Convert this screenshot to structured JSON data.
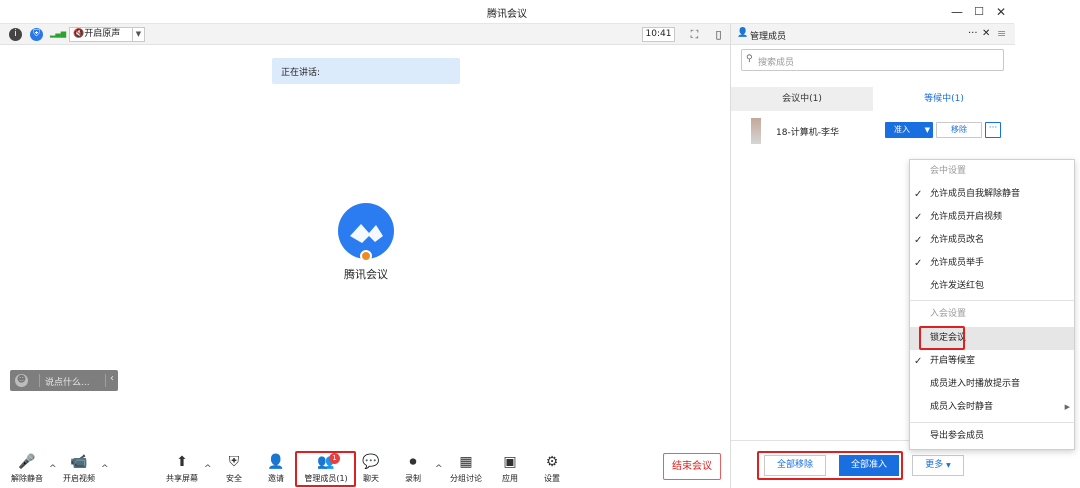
{
  "window": {
    "title": "腾讯会议",
    "minimize": "—",
    "maximize": "☐",
    "close": "✕"
  },
  "infobar": {
    "info_icon": "i",
    "shield_icon": "⛨",
    "signal_icon": "▂▄▆",
    "original_sound_label": "开启原声",
    "time": "10:41",
    "fullscreen_icon": "⛶",
    "layout_icon": "▯"
  },
  "stage": {
    "speaking_label": "正在讲话:",
    "app_name": "腾讯会议",
    "chat_placeholder": "说点什么..."
  },
  "toolbar": {
    "items": [
      {
        "label": "解除静音",
        "icon": "🎤"
      },
      {
        "label": "开启视频",
        "icon": "📹"
      },
      {
        "label": "共享屏幕",
        "icon": "⬆"
      },
      {
        "label": "安全",
        "icon": "⛨"
      },
      {
        "label": "邀请",
        "icon": "👤"
      },
      {
        "label": "管理成员(1)",
        "icon": "👥",
        "badge": "1"
      },
      {
        "label": "聊天",
        "icon": "💬"
      },
      {
        "label": "录制",
        "icon": "⏺"
      },
      {
        "label": "分组讨论",
        "icon": "▦"
      },
      {
        "label": "应用",
        "icon": "▣"
      },
      {
        "label": "设置",
        "icon": "⚙"
      }
    ],
    "end_meeting": "结束会议"
  },
  "panel": {
    "title": "管理成员",
    "more": "···",
    "close": "✕",
    "menu_icon": "≡",
    "search_placeholder": "搜索成员",
    "tabs": [
      {
        "label": "会议中(1)"
      },
      {
        "label": "等候中(1)"
      }
    ],
    "member": {
      "name": "18-计算机-李华",
      "admit": "准入",
      "remove": "移除",
      "more": "···"
    },
    "footer": {
      "remove_all": "全部移除",
      "admit_all": "全部准入",
      "more": "更多"
    }
  },
  "menu": {
    "section1": "会中设置",
    "items1": [
      {
        "label": "允许成员自我解除静音",
        "checked": true
      },
      {
        "label": "允许成员开启视频",
        "checked": true
      },
      {
        "label": "允许成员改名",
        "checked": true
      },
      {
        "label": "允许成员举手",
        "checked": true
      },
      {
        "label": "允许发送红包",
        "checked": false
      }
    ],
    "section2": "入会设置",
    "items2": [
      {
        "label": "锁定会议",
        "checked": false
      },
      {
        "label": "开启等候室",
        "checked": true
      },
      {
        "label": "成员进入时播放提示音",
        "checked": false
      },
      {
        "label": "成员入会时静音",
        "checked": false
      }
    ],
    "export": "导出参会成员"
  }
}
